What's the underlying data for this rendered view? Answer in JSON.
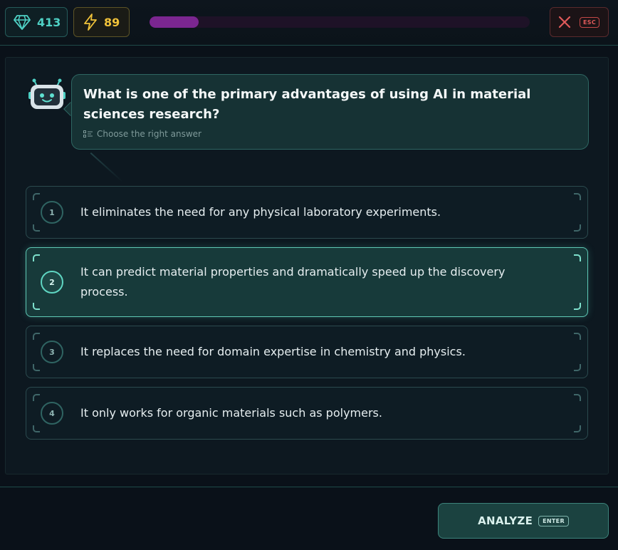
{
  "header": {
    "gems": {
      "icon": "diamond-icon",
      "value": "413",
      "color": "#4fd1c5"
    },
    "energy": {
      "icon": "lightning-icon",
      "value": "89",
      "color": "#f0c23a"
    },
    "progress": {
      "fraction": 0.13,
      "color": "#7b2690"
    },
    "close": {
      "icon": "close-icon",
      "shortcut": "ESC"
    }
  },
  "question": {
    "avatar": "robot-icon",
    "text": "What is one of the primary advantages of using AI in material sciences research?",
    "hint": "Choose the right answer",
    "hint_icon": "list-icon"
  },
  "options": [
    {
      "number": "1",
      "text": "It eliminates the need for any physical laboratory experiments.",
      "selected": false
    },
    {
      "number": "2",
      "text": "It can predict material properties and dramatically speed up the discovery process.",
      "selected": true
    },
    {
      "number": "3",
      "text": "It replaces the need for domain expertise in chemistry and physics.",
      "selected": false
    },
    {
      "number": "4",
      "text": "It only works for organic materials such as polymers.",
      "selected": false
    }
  ],
  "footer": {
    "analyze_label": "ANALYZE",
    "analyze_shortcut": "ENTER"
  },
  "colors": {
    "accent": "#5fc8b5",
    "danger": "#e05a5a"
  }
}
